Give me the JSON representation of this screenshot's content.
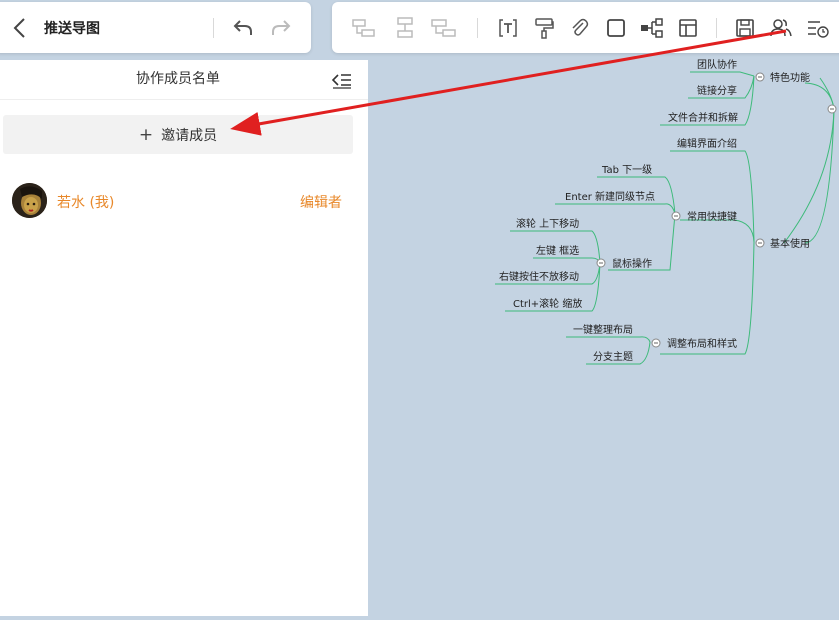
{
  "header": {
    "title": "推送导图"
  },
  "panel": {
    "title": "协作成员名单",
    "invite_label": "邀请成员",
    "member": {
      "name": "若水 (我)",
      "role": "编辑者"
    }
  },
  "mindmap": {
    "nodes": [
      "团队协作",
      "特色功能",
      "链接分享",
      "文件合并和拆解",
      "编辑界面介绍",
      "Tab 下一级",
      "Enter 新建同级节点",
      "常用快捷键",
      "基本使用",
      "滚轮 上下移动",
      "左键 框选",
      "鼠标操作",
      "右键按住不放移动",
      "Ctrl+滚轮 缩放",
      "一键整理布局",
      "调整布局和样式",
      "分支主题"
    ]
  },
  "colors": {
    "accent": "#e8882a",
    "branch": "#3dba7a",
    "canvas": "#c4d3e2",
    "arrow": "#e02020"
  }
}
